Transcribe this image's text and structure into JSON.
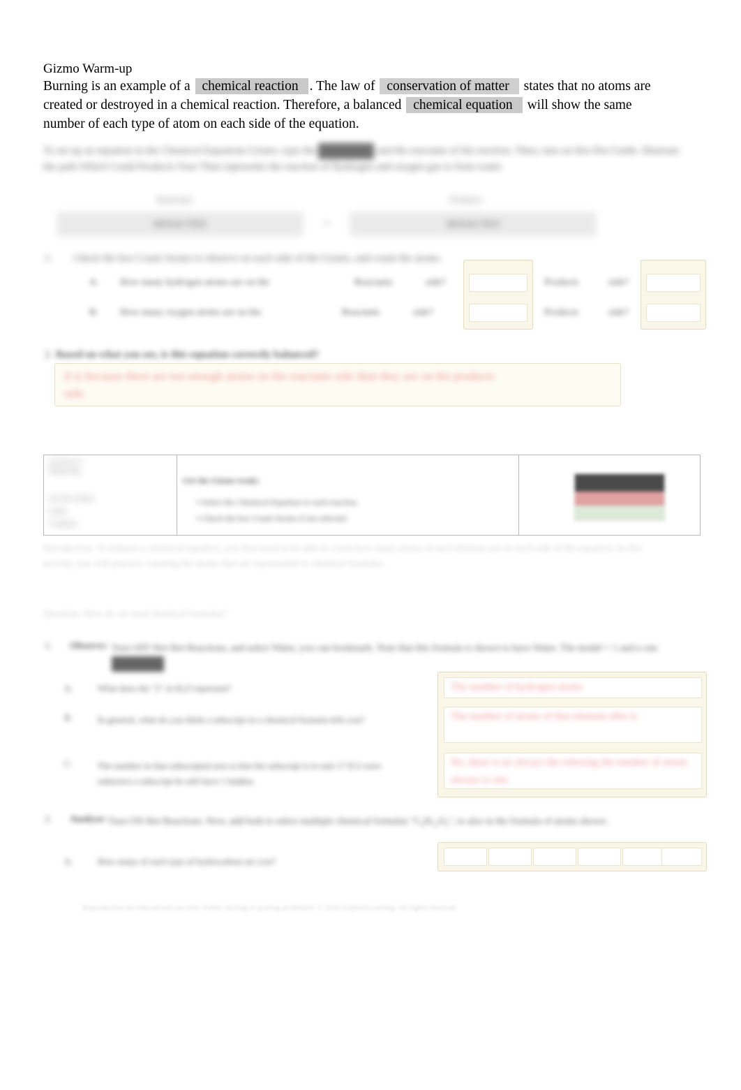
{
  "document": {
    "type": "worksheet",
    "page_background": "#ffffff",
    "highlight_color": "#c9c9c9",
    "answer_box_background": "#fdfcf3",
    "answer_box_border": "#e6e0c4",
    "red_answer_color": "#ef8a8a",
    "redaction_color": "#6f6f6f"
  },
  "warmup": {
    "title": "Gizmo Warm-up",
    "text_1": "Burning is an example of a",
    "highlight_1": "chemical reaction",
    "text_2": ". The law of",
    "highlight_2": "conservation of matter",
    "text_3": "states that no atoms are created or destroyed in a chemical reaction. Therefore, a balanced",
    "highlight_3": "chemical equation",
    "text_4": "will show the same number of each type of atom on each side of the equation."
  },
  "intro_paragraph": {
    "legible": false,
    "line_1": "To set up an equation in the Chemical Equations Gizmo, type the",
    "redacted_1": "REDACTED",
    "line_2": "and the reactants of the",
    "line_3": "reaction. Then, turn on Hot Hot Guide. Illustrate the path Which Could Products Your Then represents the",
    "line_4": "reaction of Hydrogen and oxygen gas to form water."
  },
  "reaction_table": {
    "legible": false,
    "header_left": "Reactants",
    "header_right": "Products",
    "field_left": "REDACTED",
    "field_right": "REDACTED",
    "operator": "→"
  },
  "question_1": {
    "number": "1.",
    "prompt": "Check the box Count Atoms to observe on each side of the Gizmo, and count the atoms.",
    "legible": false,
    "rows": [
      {
        "letter": "A.",
        "text": "How many hydrogen atoms are on the",
        "label_mid": "Reactants",
        "label_side": "side?",
        "input_1": "",
        "label_products": "Products",
        "label_side_2": "side?",
        "input_2": ""
      },
      {
        "letter": "B.",
        "text": "How many oxygen atoms are on the",
        "label_mid": "Reactants",
        "label_side": "side?",
        "input_1": "",
        "label_products": "Products",
        "label_side_2": "side?",
        "input_2": ""
      }
    ]
  },
  "question_2": {
    "number": "2.",
    "prompt": "Based on what you see, is this equation correctly balanced?",
    "legible": false,
    "answer": "It is because there are not enough atoms on the reactants side than they are on the products side."
  },
  "info_table": {
    "legible": false,
    "col_1_lines": [
      "Activity A:",
      "Balancing",
      "",
      "Get the Gizmo",
      "ready:",
      "",
      "Continue"
    ],
    "col_2_title": "Get the Gizmo ready:",
    "col_2_items": [
      "Select the Chemical Equation to each reaction.",
      "Check the box Count Atoms if not selected."
    ],
    "thumbnail": "gizmo-screenshot-thumbnail"
  },
  "introduction_paragraph": {
    "legible": false,
    "label": "Introduction:",
    "text": "To balance a chemical equation, you first need to be able to count how many atoms of each element are on each side of the equation. In this activity, you will practice counting the atoms that are represented in chemical formulas."
  },
  "question_heading": {
    "legible": false,
    "text": "Question: How do we read chemical formulas?"
  },
  "question_3": {
    "number": "1.",
    "label": "Observe:",
    "prompt": "Turn OFF Hot Hot Reactions, and select Water, you can bookmark. Note that this formula is shown to have Water. The model + 1 and a one",
    "redacted": "REDACTED",
    "legible": false,
    "sub_items": [
      {
        "letter": "A.",
        "text": "What does the \"2\" in H₂O represent?",
        "answer": "The number of hydrogen atoms"
      },
      {
        "letter": "B.",
        "text": "In general, what do you think a subscript in a chemical formula tells you?",
        "answer": "The number of atoms of that element after it."
      },
      {
        "letter": "C.",
        "text": "The number in that subscripted area is that the subscript is in unit 1? If it were unknown a subscript be still have 1 hidden.",
        "answer": "No, there is no always the referring the number of atoms always is one."
      }
    ]
  },
  "question_4": {
    "number": "2.",
    "label": "Analyze:",
    "prompt": "Turn ON Hot Reactions. Now, add both to select multiple chemical formulas \"C₆H₁₂O₆\", to also in the formula of atoms shown.",
    "legible": false,
    "sub_items": [
      {
        "letter": "A.",
        "text": "How many of each type of hydrocarbon are you?",
        "answer_cells": [
          "",
          "",
          "",
          "",
          "",
          ""
        ]
      }
    ]
  },
  "footer": {
    "legible": false,
    "text": "Reproduction for educational use only. Public sharing or posting prohibited. © 2020 ExploreLearning. All rights reserved."
  }
}
